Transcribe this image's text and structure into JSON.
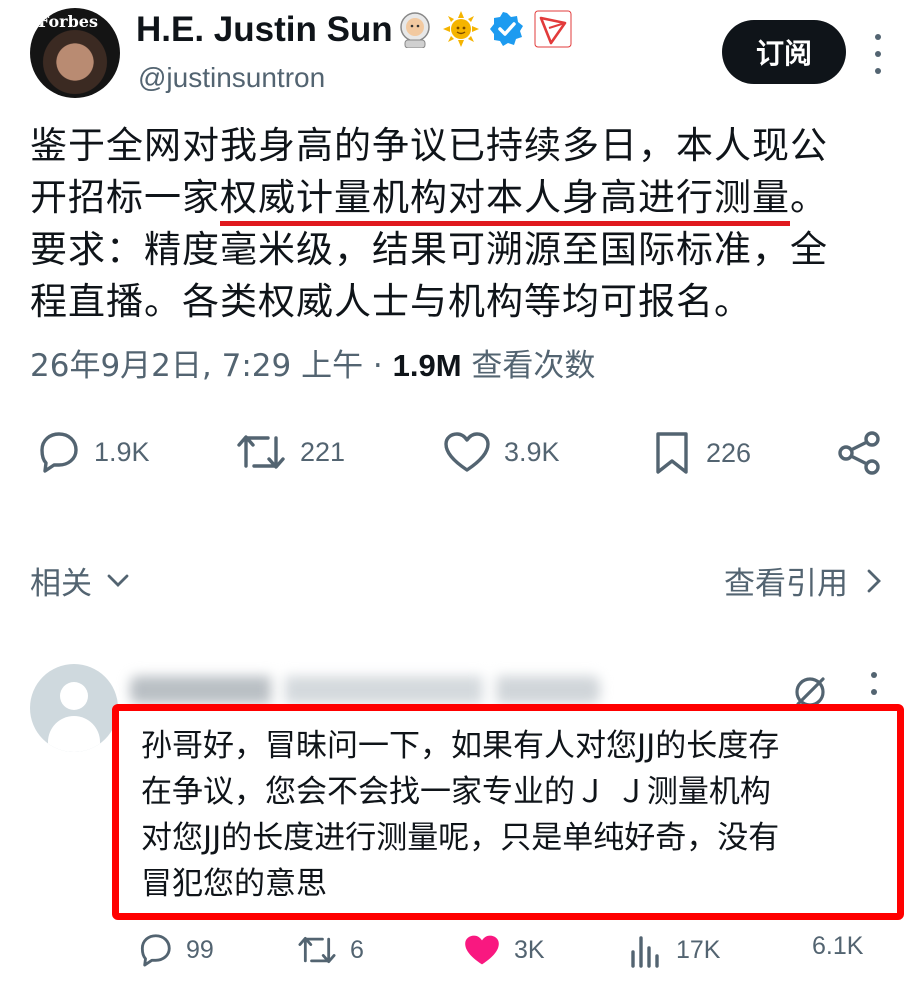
{
  "user": {
    "avatar_text": "Forbes",
    "name": "H.E. Justin Sun",
    "handle": "@justinsuntron",
    "badges": [
      "astronaut-emoji",
      "sun-emoji",
      "verified-badge",
      "tron-logo"
    ]
  },
  "subscribe_label": "订阅",
  "tweet": {
    "line1": "鉴于全网对我身高的争议已持续多日，本人现公",
    "line2_pre": "开招标一家",
    "line2_highlight": "权威计量机构对本人身高进行测量",
    "line2_post": "。",
    "line3": "要求：精度毫米级，结果可溯源至国际标准，全",
    "line4": "程直播。各类权威人士与机构等均可报名。"
  },
  "meta": {
    "datetime": "26年9月2日, 7:29 上午 · ",
    "views_count": "1.9M",
    "views_label": " 查看次数"
  },
  "actions": {
    "replies": "1.9K",
    "reposts": "221",
    "likes": "3.9K",
    "bookmarks": "226"
  },
  "related_label": "相关",
  "quotes_label": "查看引用",
  "reply": {
    "line1": "孙哥好，冒昧问一下，如果有人对您JJ的长度存",
    "line2": "在争议，您会不会找一家专业的Ｊ Ｊ测量机构",
    "line3": "对您JJ的长度进行测量呢，只是单纯好奇，没有",
    "line4": "冒犯您的意思",
    "replies": "99",
    "reposts": "6",
    "likes": "3K",
    "views": "17K",
    "share_partial": "6.1K"
  },
  "colors": {
    "highlight": "#e0191e",
    "reply_border": "#ff0000",
    "like_pink": "#f91880",
    "verified": "#1d9bf0"
  }
}
